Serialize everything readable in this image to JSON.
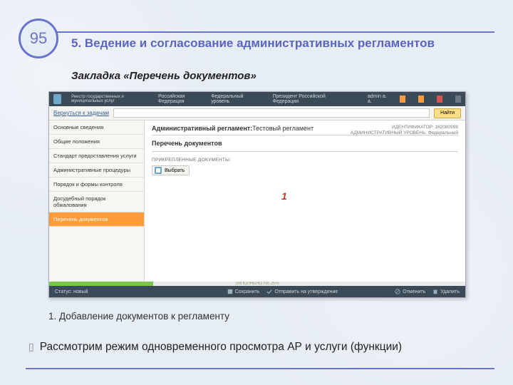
{
  "slide": {
    "number": "95",
    "title": "5. Ведение и согласование административных регламентов",
    "subtitle": "Закладка «Перечень документов»",
    "caption": "1. Добавление документов к регламенту",
    "bullet": "Рассмотрим режим одновременного просмотра АР и услуги (функции)"
  },
  "topbar": {
    "logo_text": "Реестр государственных и муниципальных услуг",
    "region": "Российская Федерация",
    "level": "Федеральный уровень",
    "president": "Президент Российской Федерации",
    "user": "admin a. a."
  },
  "searchbar": {
    "back": "Вернуться к задачам",
    "placeholder": "",
    "find": "Найти"
  },
  "sidebar": {
    "items": [
      "Основные сведения",
      "Общие положения",
      "Стандарт предоставления услуги",
      "Административные процедуры",
      "Порядок и формы контроля",
      "Досудебный порядок обжалования",
      "Перечень документов"
    ],
    "active_index": 6
  },
  "main": {
    "crumb_prefix": "Административный регламент:",
    "crumb_name": "Тестовый регламент",
    "section": "Перечень документов",
    "meta_id": "ИДЕНТИФИКАТОР: 162080998",
    "meta_level": "АДМИНИСТРАТИВНЫЙ УРОВЕНЬ: Федеральный",
    "attach_label": "ПРИКРЕПЛЕННЫЕ ДОКУМЕНТЫ:",
    "attach_btn": "Выбрать",
    "callout": "1"
  },
  "greenstrip": {
    "progress_text": "ЗАПОЛНЕНО НА 25%"
  },
  "statusbar": {
    "status": "Статус: новый",
    "save": "Сохранить",
    "submit": "Отправить на утверждение",
    "cancel": "Отменить",
    "delete": "Удалить"
  }
}
